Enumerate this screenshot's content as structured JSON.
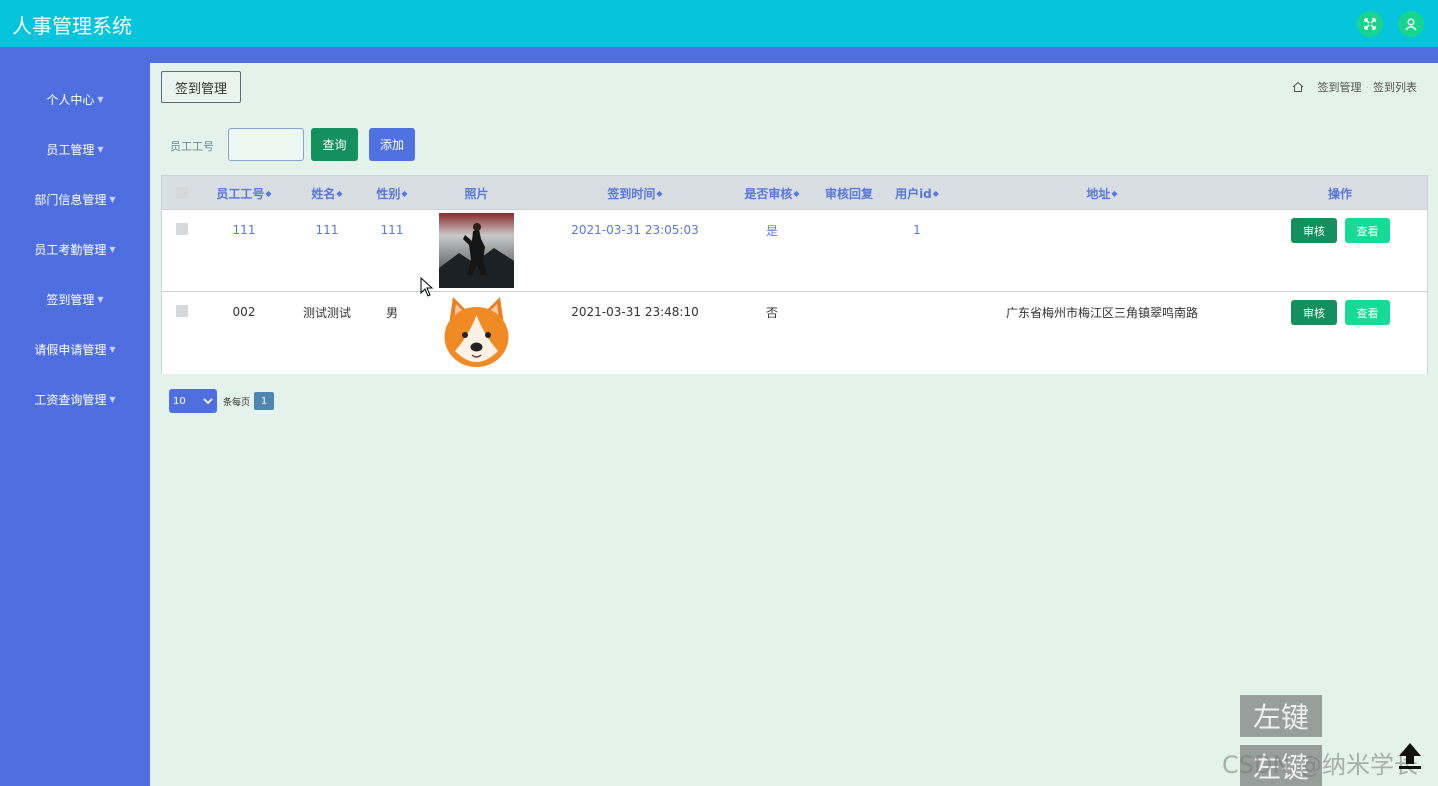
{
  "app": {
    "title": "人事管理系统"
  },
  "header_icons": [
    "fullscreen-icon",
    "user-icon"
  ],
  "sidebar": {
    "items": [
      {
        "label": "个人中心"
      },
      {
        "label": "员工管理"
      },
      {
        "label": "部门信息管理"
      },
      {
        "label": "员工考勤管理"
      },
      {
        "label": "签到管理"
      },
      {
        "label": "请假申请管理"
      },
      {
        "label": "工资查询管理"
      }
    ]
  },
  "page": {
    "tag": "签到管理",
    "breadcrumb": [
      "签到管理",
      "签到列表"
    ]
  },
  "search": {
    "label": "员工工号",
    "value": "",
    "query_label": "查询",
    "add_label": "添加"
  },
  "table": {
    "columns": [
      {
        "label": "员工工号",
        "sortable": true
      },
      {
        "label": "姓名",
        "sortable": true
      },
      {
        "label": "性别",
        "sortable": true
      },
      {
        "label": "照片",
        "sortable": false
      },
      {
        "label": "签到时间",
        "sortable": true
      },
      {
        "label": "是否审核",
        "sortable": true
      },
      {
        "label": "审核回复",
        "sortable": false
      },
      {
        "label": "用户id",
        "sortable": true
      },
      {
        "label": "地址",
        "sortable": true
      },
      {
        "label": "操作",
        "sortable": false
      }
    ],
    "sort_glyph": "◆",
    "rows": [
      {
        "emp_no": "111",
        "name": "111",
        "gender": "111",
        "photo": "game-character-photo",
        "checkin_time": "2021-03-31 23:05:03",
        "reviewed": "是",
        "review_reply": "",
        "user_id": "1",
        "address": "",
        "review_label": "审核",
        "view_label": "查看"
      },
      {
        "emp_no": "002",
        "name": "测试测试",
        "gender": "男",
        "photo": "dog-avatar-photo",
        "checkin_time": "2021-03-31 23:48:10",
        "reviewed": "否",
        "review_reply": "",
        "user_id": "",
        "address": "广东省梅州市梅江区三角镇翠鸣南路",
        "review_label": "审核",
        "view_label": "查看"
      }
    ]
  },
  "pagination": {
    "page_size": "10",
    "per_page_label": "条每页",
    "current_page": "1"
  },
  "overlay": {
    "key_hint": "左键",
    "watermark": "CSDN @纳米学长"
  },
  "colors": {
    "header": "#04c5dc",
    "sidebar": "#4f6fe0",
    "primary_green": "#14905e",
    "accent_green": "#16db97",
    "background": "#e4f2ec"
  }
}
